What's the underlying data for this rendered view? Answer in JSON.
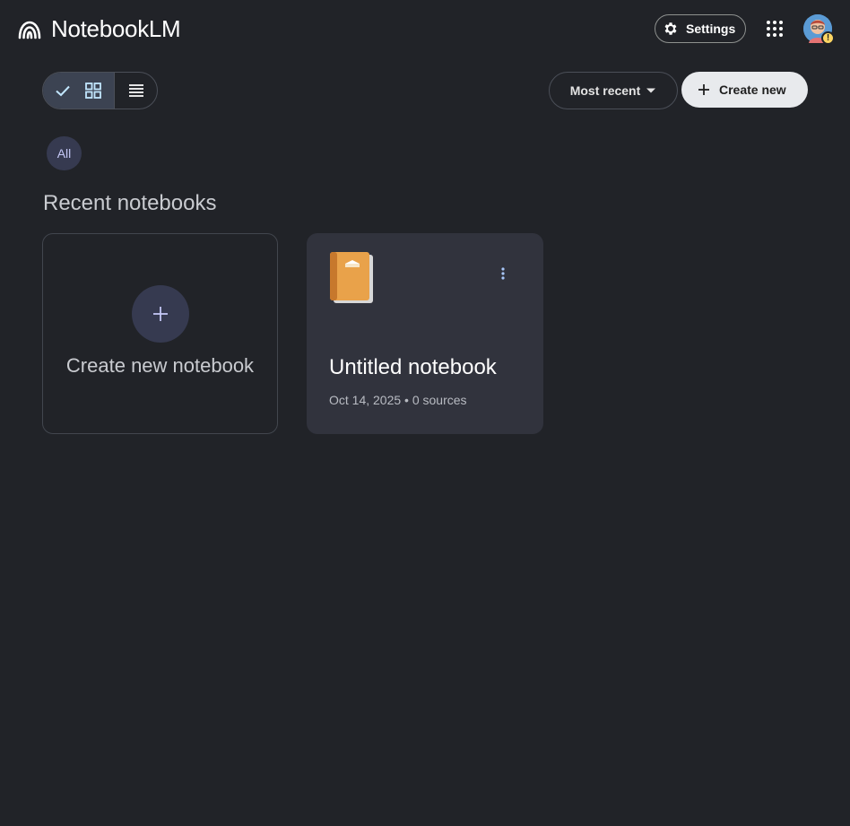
{
  "app": {
    "title": "NotebookLM"
  },
  "header": {
    "settings_label": "Settings",
    "apps_icon": "apps-grid-icon",
    "avatar_badge": "!"
  },
  "toolbar": {
    "grid_view_selected": true,
    "sort_label": "Most recent",
    "create_label": "Create new"
  },
  "filters": {
    "chips": [
      "All"
    ]
  },
  "section": {
    "title": "Recent notebooks"
  },
  "cards": {
    "new_label": "Create new notebook",
    "notebooks": [
      {
        "emoji": "📙",
        "title": "Untitled notebook",
        "meta": "Oct 14, 2025 • 0 sources"
      }
    ]
  },
  "colors": {
    "background": "#212328",
    "card": "#31333d",
    "accent": "#c4c7f5",
    "chip_bg": "#363a50"
  }
}
